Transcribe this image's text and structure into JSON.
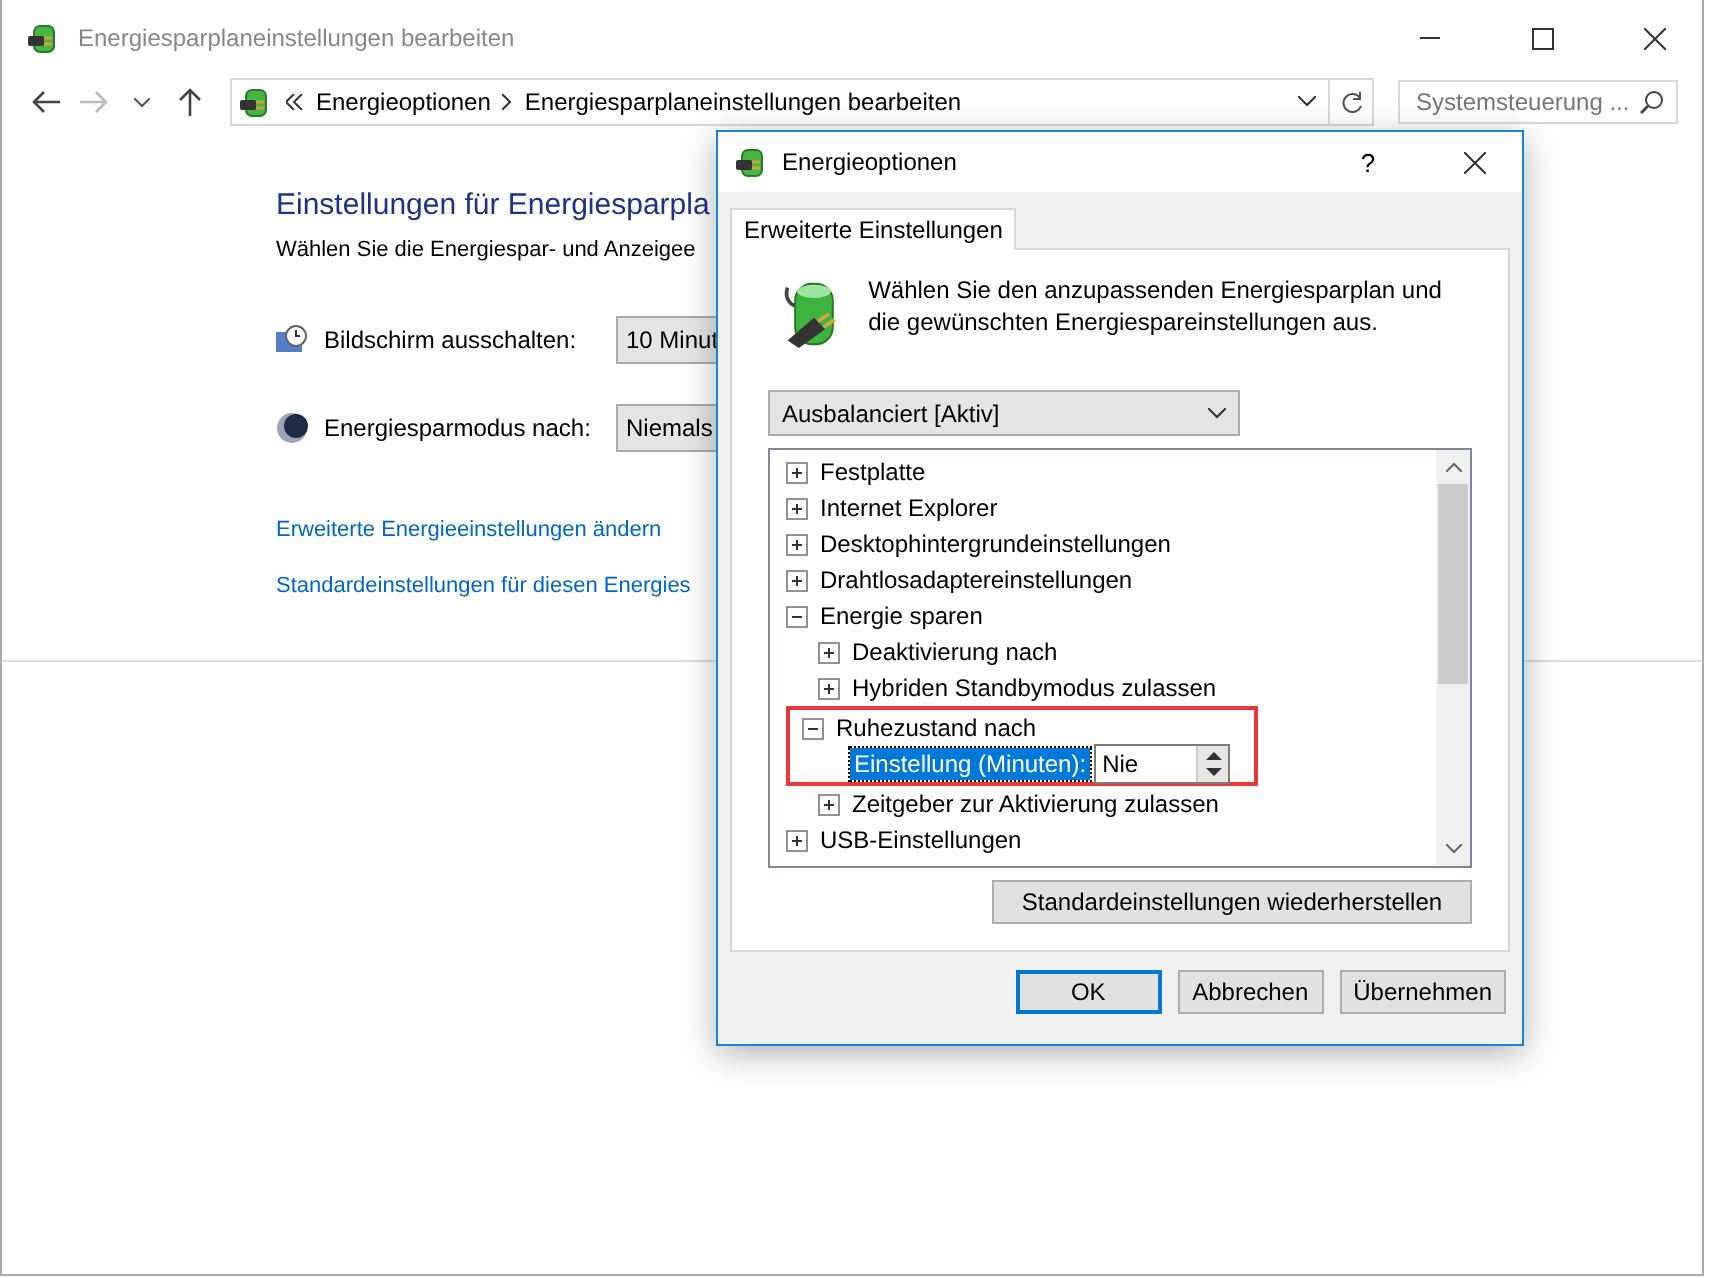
{
  "window": {
    "title": "Energiesparplaneinstellungen bearbeiten"
  },
  "address_bar": {
    "breadcrumbs": [
      "Energieoptionen",
      "Energiesparplaneinstellungen bearbeiten"
    ]
  },
  "search": {
    "placeholder": "Systemsteuerung ..."
  },
  "plan_settings": {
    "heading": "Einstellungen für Energiesparpla",
    "description": "Wählen Sie die Energiespar- und Anzeigee",
    "settings": [
      {
        "kind": "display",
        "label": "Bildschirm ausschalten:",
        "value": "10 Minut"
      },
      {
        "kind": "sleep",
        "label": "Energiesparmodus nach:",
        "value": "Niemals"
      }
    ],
    "links": [
      "Erweiterte Energieeinstellungen ändern",
      "Standardeinstellungen für diesen Energies"
    ]
  },
  "dialog": {
    "title": "Energieoptionen",
    "help_button": "?",
    "tabs": [
      {
        "label": "Erweiterte Einstellungen",
        "selected": true
      }
    ],
    "intro": "Wählen Sie den anzupassenden Energiesparplan und die gewünschten Energiespareinstellungen aus.",
    "plan_select": {
      "value": "Ausbalanciert [Aktiv]"
    },
    "tree": [
      {
        "label": "Festplatte",
        "expanded": false
      },
      {
        "label": "Internet Explorer",
        "expanded": false
      },
      {
        "label": "Desktophintergrundeinstellungen",
        "expanded": false
      },
      {
        "label": "Drahtlosadaptereinstellungen",
        "expanded": false
      },
      {
        "label": "Energie sparen",
        "expanded": true,
        "children": [
          {
            "label": "Deaktivierung nach",
            "expanded": false
          },
          {
            "label": "Hybriden Standbymodus zulassen",
            "expanded": false
          },
          {
            "label": "Ruhezustand nach",
            "expanded": true,
            "highlighted": true,
            "children": [
              {
                "kind": "setting",
                "label": "Einstellung (Minuten):",
                "value": "Nie",
                "selected": true
              }
            ]
          },
          {
            "label": "Zeitgeber zur Aktivierung zulassen",
            "expanded": false
          }
        ]
      },
      {
        "label": "USB-Einstellungen",
        "expanded": false
      }
    ],
    "restore_button": "Standardeinstellungen wiederherstellen",
    "buttons": [
      {
        "label": "OK",
        "default": true
      },
      {
        "label": "Abbrechen",
        "default": false
      },
      {
        "label": "Übernehmen",
        "default": false
      }
    ]
  }
}
